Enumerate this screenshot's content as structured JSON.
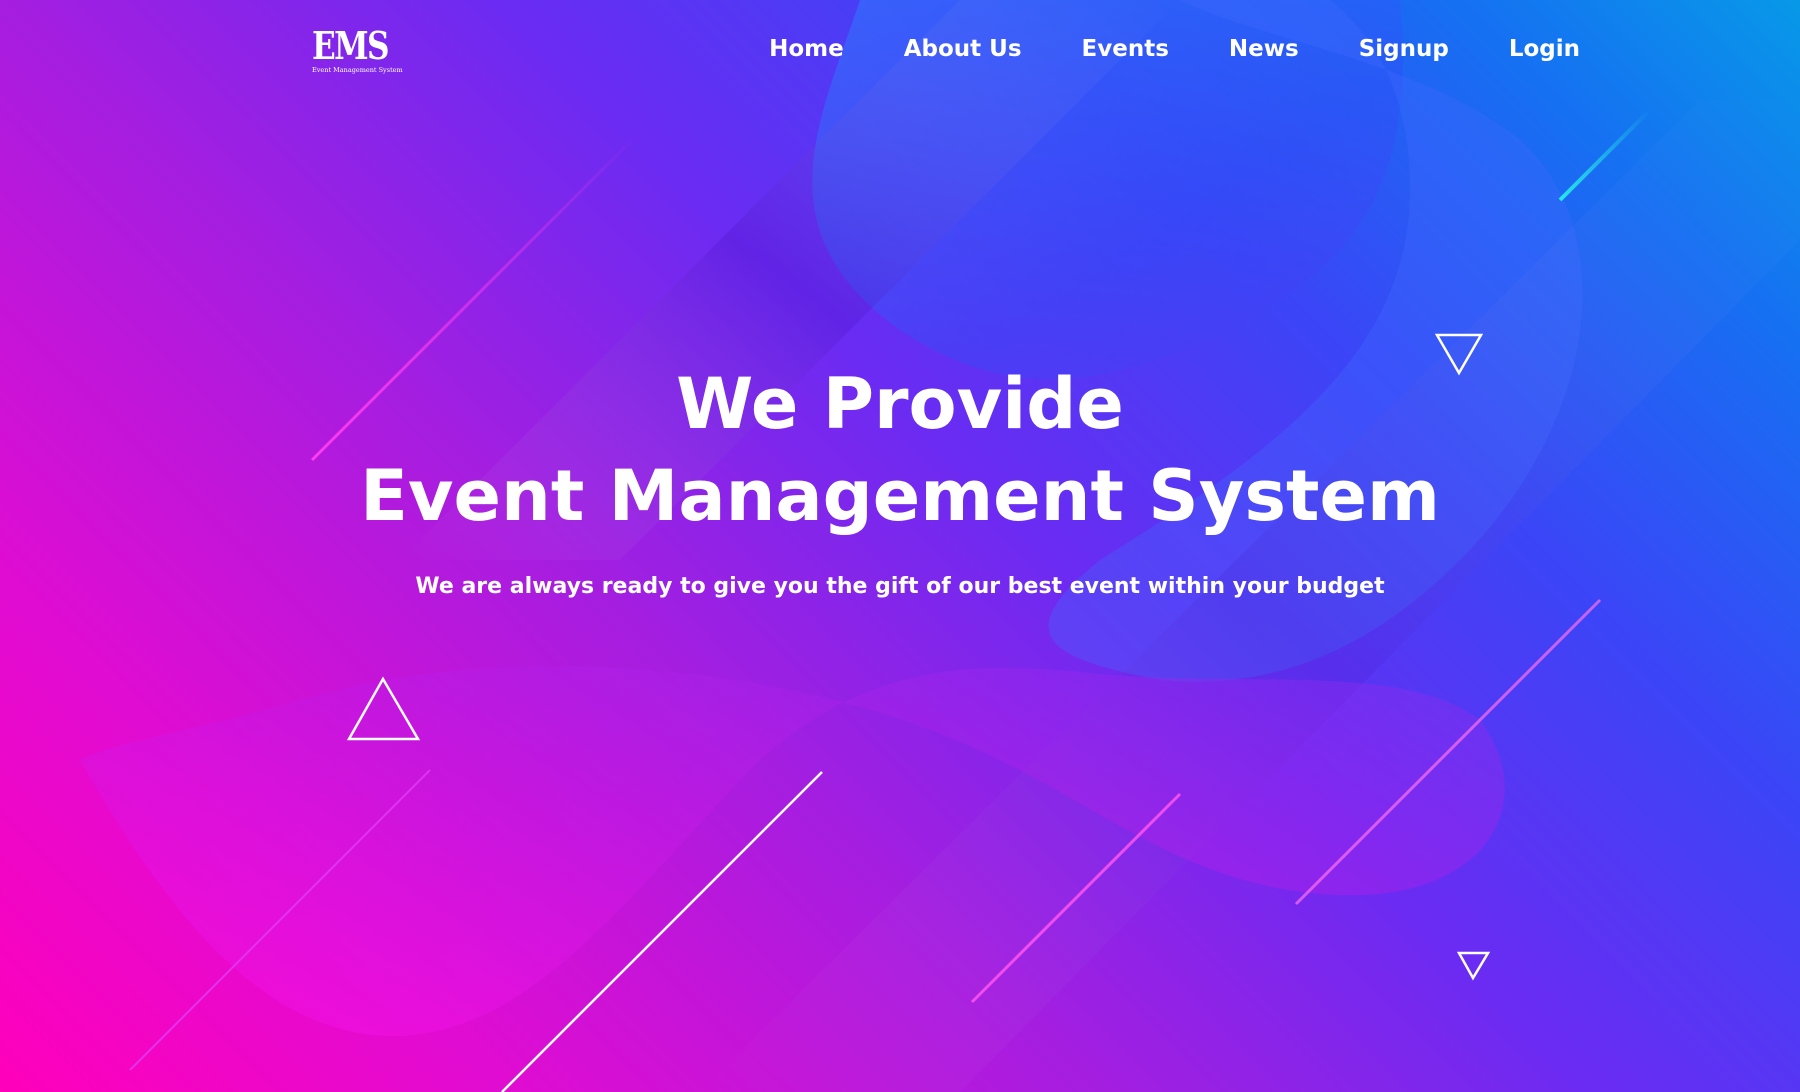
{
  "brand": {
    "logo_mark": "EMS",
    "logo_tagline": "Event Management System"
  },
  "nav": {
    "items": [
      {
        "label": "Home"
      },
      {
        "label": "About Us"
      },
      {
        "label": "Events"
      },
      {
        "label": "News"
      },
      {
        "label": "Signup"
      },
      {
        "label": "Login"
      }
    ]
  },
  "hero": {
    "title_line1": "We Provide",
    "title_line2": "Event Management System",
    "subtitle": "We are always ready to give you the gift of our best event within your budget"
  },
  "colors": {
    "pink": "#ff00bb",
    "purple": "#6b2bf2",
    "blue": "#1670f2",
    "cyan_line": "#1fe0e0",
    "text": "#ffffff"
  }
}
